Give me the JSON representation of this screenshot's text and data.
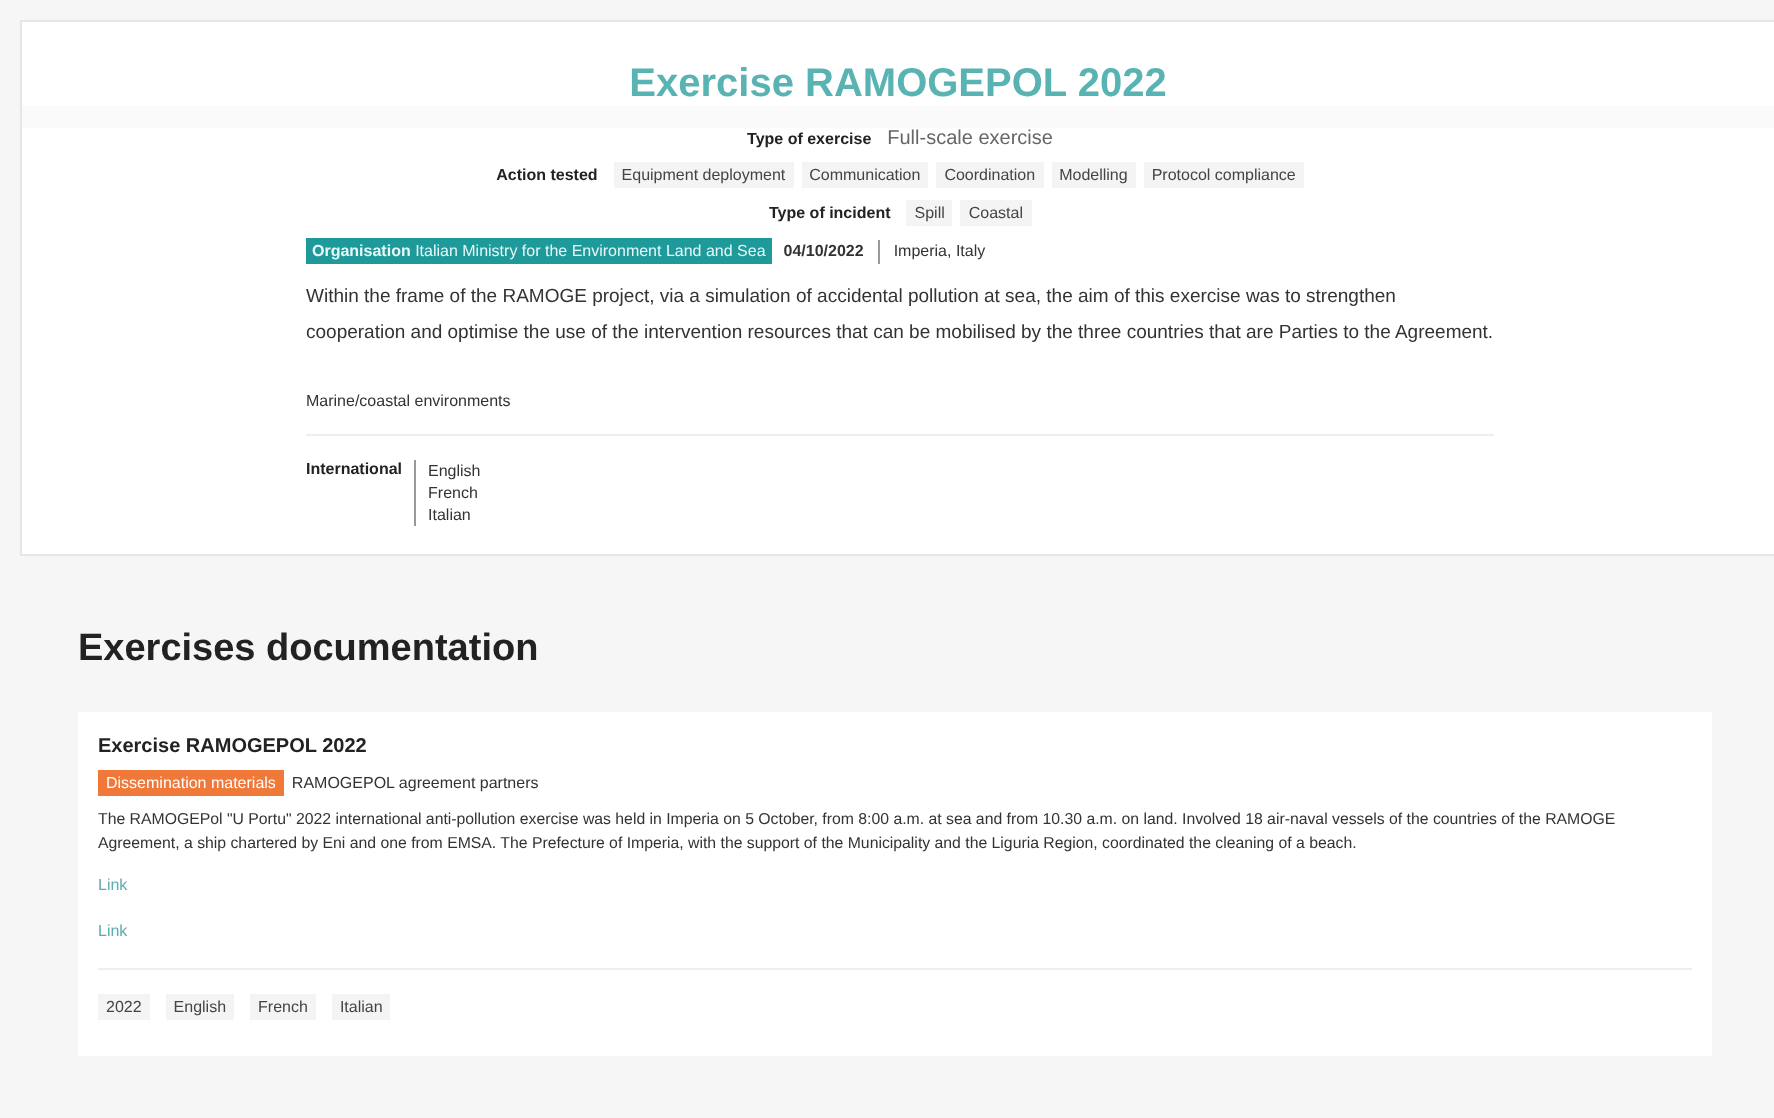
{
  "title": "Exercise RAMOGEPOL 2022",
  "type_of_exercise": {
    "label": "Type of exercise",
    "value": "Full-scale exercise"
  },
  "action_tested": {
    "label": "Action tested",
    "tags": [
      "Equipment deployment",
      "Communication",
      "Coordination",
      "Modelling",
      "Protocol compliance"
    ]
  },
  "type_of_incident": {
    "label": "Type of incident",
    "tags": [
      "Spill",
      "Coastal"
    ]
  },
  "organisation": {
    "label": "Organisation",
    "value": "Italian Ministry for the Environment Land and Sea"
  },
  "date": "04/10/2022",
  "location": "Imperia, Italy",
  "description": "Within the frame of the RAMOGE project, via a simulation of accidental pollution at sea, the aim of this exercise was to strengthen cooperation and optimise the use of the intervention resources that can be mobilised by the three countries that are Parties to the Agreement.",
  "environment": "Marine/coastal environments",
  "scope": {
    "label": "International",
    "languages": [
      "English",
      "French",
      "Italian"
    ]
  },
  "documentation": {
    "heading": "Exercises documentation",
    "items": [
      {
        "title": "Exercise RAMOGEPOL 2022",
        "category": "Dissemination materials",
        "source": "RAMOGEPOL agreement partners",
        "text": "The RAMOGEPol \"U Portu\" 2022 international anti-pollution exercise was held in Imperia on 5 October, from 8:00 a.m. at sea and from 10.30 a.m. on land. Involved 18 air-naval vessels of the countries of the RAMOGE Agreement, a ship chartered by Eni and one from EMSA. The Prefecture of Imperia, with the support of the Municipality and the Liguria Region, coordinated the cleaning of a beach.",
        "links": [
          "Link",
          "Link"
        ],
        "tags": [
          "2022",
          "English",
          "French",
          "Italian"
        ]
      }
    ]
  }
}
